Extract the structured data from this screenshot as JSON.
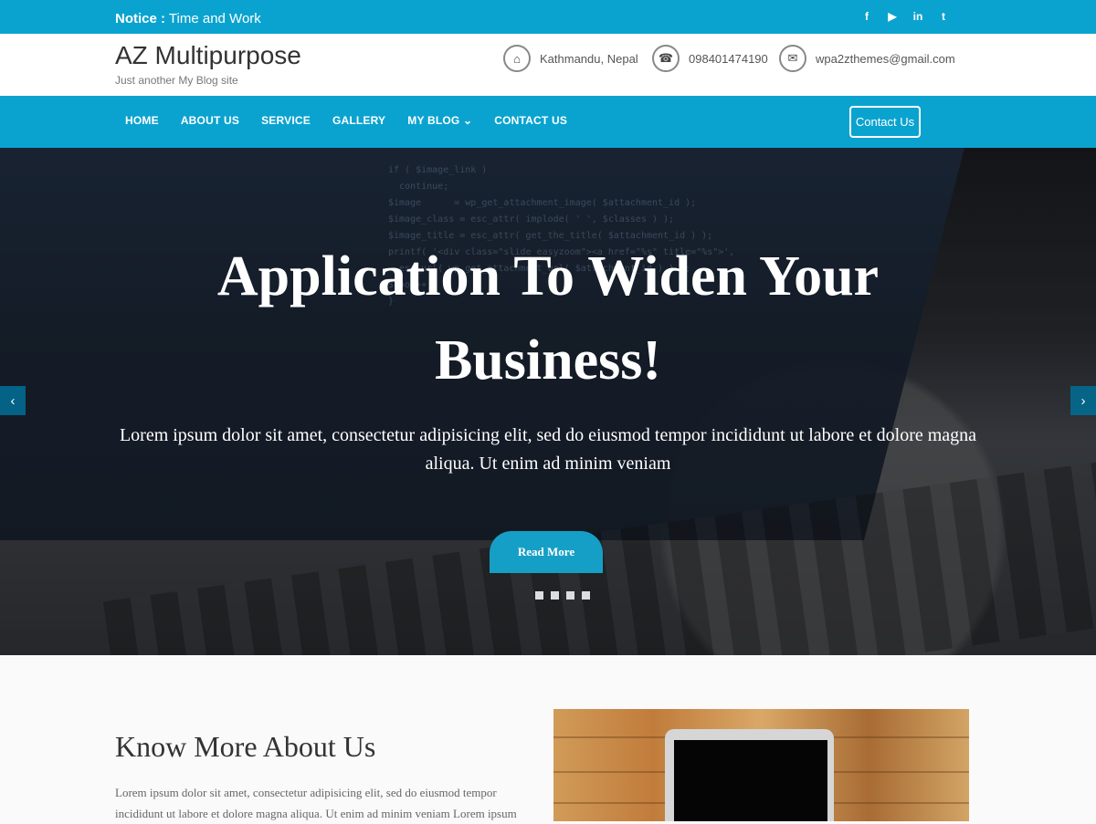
{
  "topbar": {
    "notice_label": "Notice :",
    "notice_text": "Time and Work",
    "social": [
      {
        "icon": "facebook-icon",
        "glyph": "f"
      },
      {
        "icon": "youtube-icon",
        "glyph": "▶"
      },
      {
        "icon": "linkedin-icon",
        "glyph": "in"
      },
      {
        "icon": "twitter-icon",
        "glyph": "t"
      }
    ]
  },
  "header": {
    "title": "AZ Multipurpose",
    "tagline": "Just another My Blog site",
    "contacts": [
      {
        "icon": "home-icon",
        "glyph": "⌂",
        "text": "Kathmandu, Nepal"
      },
      {
        "icon": "phone-icon",
        "glyph": "☎",
        "text": "098401474190"
      },
      {
        "icon": "envelope-icon",
        "glyph": "✉",
        "text": "wpa2zthemes@gmail.com"
      }
    ]
  },
  "nav": {
    "items": [
      {
        "label": "HOME"
      },
      {
        "label": "ABOUT US"
      },
      {
        "label": "SERVICE"
      },
      {
        "label": "GALLERY"
      },
      {
        "label": "MY BLOG"
      },
      {
        "label": "CONTACT US"
      }
    ],
    "dropdown_glyph": "⌄",
    "contact_button": "Contact Us"
  },
  "hero": {
    "title": "Application To Widen Your Business!",
    "text": "Lorem ipsum dolor sit amet, consectetur adipisicing elit, sed do eiusmod tempor incididunt ut labore et dolore magna aliqua. Ut enim ad minim veniam",
    "button": "Read More",
    "left_arrow": "‹",
    "right_arrow": "›",
    "dots_count": 4,
    "code_text": "if ( $image_link )\n  continue;\n$image      = wp_get_attachment_image( $attachment_id );\n$image_class = esc_attr( implode( ' ', $classes ) );\n$image_title = esc_attr( get_the_title( $attachment_id ) );\nprintf( '<div class=\"slide easyzoom\"><a href=\"%s\" title=\"%s\">',\n  esc_url( wp_get_attachment_url( $attachment_id ) ) );\n$loop++;\n}"
  },
  "about": {
    "title": "Know More About Us",
    "text": "Lorem ipsum dolor sit amet, consectetur adipisicing elit, sed do eiusmod tempor incididunt ut labore et dolore magna aliqua. Ut enim ad minim veniam Lorem ipsum"
  }
}
